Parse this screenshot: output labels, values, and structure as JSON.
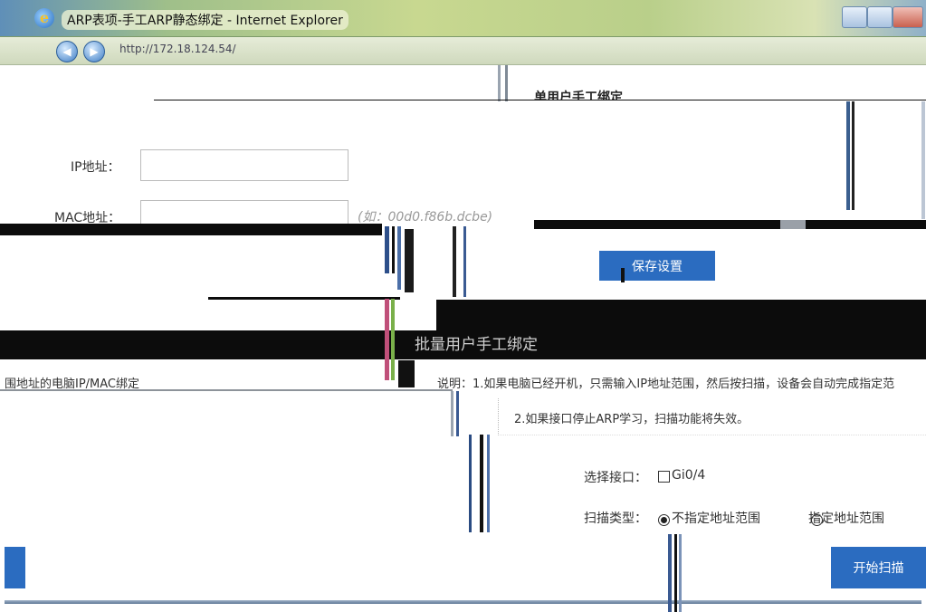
{
  "window": {
    "title": "ARP表项-手工ARP静态绑定 - Internet Explorer"
  },
  "address_bar": {
    "url": "http://172.18.124.54/"
  },
  "single_bind": {
    "heading": "单用户手工绑定",
    "ip_label": "IP地址：",
    "ip_value": "",
    "mac_label": "MAC地址：",
    "mac_value": "",
    "mac_hint": "(如：00d0.f86b.dcbe)",
    "save_button": "保存设置"
  },
  "batch_bind": {
    "heading": "批量用户手工绑定",
    "left_fragment": "围地址的电脑IP/MAC绑定",
    "note_1": "说明：1.如果电脑已经开机，只需输入IP地址范围，然后按扫描，设备会自动完成指定范",
    "note_2": "2.如果接口停止ARP学习，扫描功能将失效。",
    "interface_label": "选择接口：",
    "interface_option": "Gi0/4",
    "interface_checked": false,
    "scan_type_label": "扫描类型：",
    "scan_options": [
      {
        "label": "不指定地址范围",
        "selected": true
      },
      {
        "label": "指定地址范围",
        "selected": false
      }
    ],
    "start_button": "开始扫描"
  },
  "colors": {
    "accent": "#2b6cc0",
    "glitch_dark": "#0c0c0c"
  }
}
